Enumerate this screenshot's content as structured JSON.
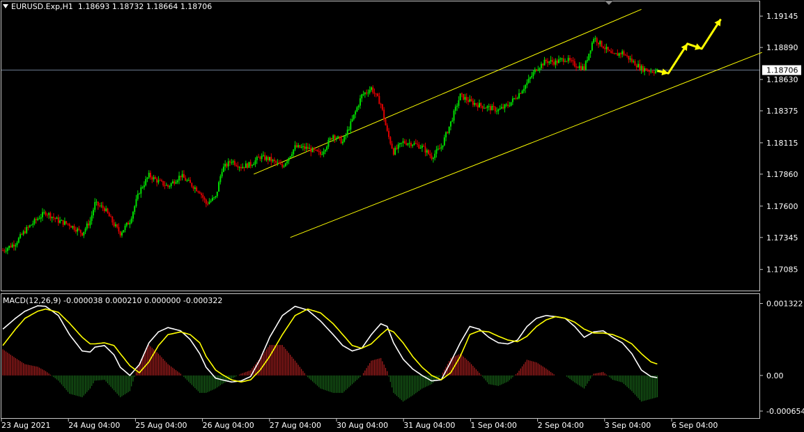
{
  "header": {
    "symbol": "EURUSD.Exp,H1",
    "ohlc": "1.18693 1.18732 1.18664 1.18706"
  },
  "macd_header": {
    "name": "MACD(12,26,9)",
    "values": "-0.000038 0.000210 0.000000 -0.000322"
  },
  "colors": {
    "background": "#000000",
    "bull": "#00e000",
    "bear": "#e00000",
    "channel": "#ffff00",
    "macd_main": "#ffffff",
    "macd_signal": "#ffff00",
    "hist_up": "#b02020",
    "hist_down": "#1a6a1a",
    "current_line": "#6f7f95"
  },
  "chart_data": [
    {
      "type": "candlestick",
      "title": "EURUSD.Exp,H1",
      "y_ticks": [
        "1.19145",
        "1.18890",
        "1.18630",
        "1.18375",
        "1.18115",
        "1.17860",
        "1.17600",
        "1.17345",
        "1.17085"
      ],
      "ylim": [
        1.17004,
        1.19225
      ],
      "current_price": "1.18706",
      "x_ticks": [
        "23 Aug 2021",
        "24 Aug 04:00",
        "25 Aug 04:00",
        "26 Aug 04:00",
        "27 Aug 04:00",
        "30 Aug 04:00",
        "31 Aug 04:00",
        "1 Sep 04:00",
        "2 Sep 04:00",
        "3 Sep 04:00",
        "6 Sep 04:00"
      ],
      "close_path": [
        [
          0,
          1.1724
        ],
        [
          8,
          1.173
        ],
        [
          14,
          1.174
        ],
        [
          22,
          1.175
        ],
        [
          27,
          1.1755
        ],
        [
          35,
          1.1748
        ],
        [
          42,
          1.1745
        ],
        [
          50,
          1.1738
        ],
        [
          55,
          1.1748
        ],
        [
          58,
          1.1762
        ],
        [
          64,
          1.1758
        ],
        [
          70,
          1.1745
        ],
        [
          74,
          1.1738
        ],
        [
          80,
          1.1748
        ],
        [
          86,
          1.1772
        ],
        [
          92,
          1.1785
        ],
        [
          98,
          1.178
        ],
        [
          104,
          1.1776
        ],
        [
          112,
          1.1785
        ],
        [
          118,
          1.1778
        ],
        [
          124,
          1.1772
        ],
        [
          128,
          1.1762
        ],
        [
          134,
          1.1767
        ],
        [
          138,
          1.179
        ],
        [
          144,
          1.1797
        ],
        [
          150,
          1.1792
        ],
        [
          156,
          1.1794
        ],
        [
          162,
          1.18
        ],
        [
          168,
          1.1798
        ],
        [
          176,
          1.1792
        ],
        [
          184,
          1.1808
        ],
        [
          192,
          1.1807
        ],
        [
          200,
          1.1802
        ],
        [
          208,
          1.1818
        ],
        [
          214,
          1.1812
        ],
        [
          220,
          1.183
        ],
        [
          226,
          1.185
        ],
        [
          232,
          1.1856
        ],
        [
          238,
          1.1843
        ],
        [
          242,
          1.182
        ],
        [
          246,
          1.1804
        ],
        [
          252,
          1.1812
        ],
        [
          258,
          1.1811
        ],
        [
          264,
          1.1808
        ],
        [
          270,
          1.18
        ],
        [
          276,
          1.1808
        ],
        [
          282,
          1.1828
        ],
        [
          288,
          1.185
        ],
        [
          294,
          1.1845
        ],
        [
          300,
          1.1842
        ],
        [
          306,
          1.184
        ],
        [
          312,
          1.1838
        ],
        [
          318,
          1.1842
        ],
        [
          324,
          1.185
        ],
        [
          330,
          1.186
        ],
        [
          336,
          1.1872
        ],
        [
          342,
          1.1878
        ],
        [
          348,
          1.1877
        ],
        [
          354,
          1.188
        ],
        [
          360,
          1.1875
        ],
        [
          366,
          1.1872
        ],
        [
          372,
          1.1897
        ],
        [
          378,
          1.189
        ],
        [
          384,
          1.1882
        ],
        [
          390,
          1.1885
        ],
        [
          396,
          1.1878
        ],
        [
          402,
          1.1872
        ],
        [
          408,
          1.187
        ],
        [
          412,
          1.187
        ]
      ],
      "forecast_path": [
        [
          412,
          1.187
        ],
        [
          419,
          1.1868
        ],
        [
          431,
          1.1892
        ],
        [
          440,
          1.1888
        ],
        [
          452,
          1.1912
        ]
      ],
      "channel_upper": [
        [
          0,
          1.1786
        ],
        [
          244,
          1.192
        ]
      ],
      "channel_lower": [
        [
          23,
          1.17345
        ],
        [
          320,
          1.1885
        ]
      ]
    },
    {
      "type": "macd",
      "title": "MACD(12,26,9)",
      "y_ticks": [
        "0.001322",
        "0.00",
        "-0.000654"
      ],
      "ylim": [
        -0.00068,
        0.00138
      ],
      "main": [
        [
          0,
          0.00085
        ],
        [
          8,
          0.00105
        ],
        [
          14,
          0.00118
        ],
        [
          22,
          0.00128
        ],
        [
          27,
          0.00127
        ],
        [
          35,
          0.0011
        ],
        [
          42,
          0.00075
        ],
        [
          50,
          0.00045
        ],
        [
          55,
          0.00043
        ],
        [
          58,
          0.00052
        ],
        [
          64,
          0.00055
        ],
        [
          70,
          0.00038
        ],
        [
          74,
          0.00015
        ],
        [
          80,
          0.0
        ],
        [
          86,
          0.0002
        ],
        [
          92,
          0.0006
        ],
        [
          98,
          0.0008
        ],
        [
          104,
          0.00088
        ],
        [
          112,
          0.00082
        ],
        [
          118,
          0.00066
        ],
        [
          124,
          0.0004
        ],
        [
          128,
          0.00015
        ],
        [
          134,
          -5e-05
        ],
        [
          138,
          -8e-05
        ],
        [
          144,
          -0.00012
        ],
        [
          150,
          -0.0001
        ],
        [
          156,
          -2e-05
        ],
        [
          162,
          0.0003
        ],
        [
          168,
          0.0007
        ],
        [
          176,
          0.0011
        ],
        [
          184,
          0.00127
        ],
        [
          192,
          0.0012
        ],
        [
          200,
          0.001
        ],
        [
          208,
          0.00075
        ],
        [
          214,
          0.00055
        ],
        [
          220,
          0.00045
        ],
        [
          226,
          0.0005
        ],
        [
          232,
          0.00075
        ],
        [
          238,
          0.00095
        ],
        [
          242,
          0.0009
        ],
        [
          246,
          0.0006
        ],
        [
          252,
          0.0003
        ],
        [
          258,
          0.00012
        ],
        [
          264,
          0.0
        ],
        [
          270,
          -0.0001
        ],
        [
          276,
          -8e-05
        ],
        [
          282,
          0.00025
        ],
        [
          288,
          0.0006
        ],
        [
          294,
          0.0009
        ],
        [
          300,
          0.00085
        ],
        [
          306,
          0.0007
        ],
        [
          312,
          0.0006
        ],
        [
          318,
          0.00058
        ],
        [
          324,
          0.00065
        ],
        [
          330,
          0.0009
        ],
        [
          336,
          0.00105
        ],
        [
          342,
          0.0011
        ],
        [
          348,
          0.00108
        ],
        [
          354,
          0.00105
        ],
        [
          360,
          0.0009
        ],
        [
          366,
          0.0007
        ],
        [
          372,
          0.0008
        ],
        [
          378,
          0.00082
        ],
        [
          384,
          0.0007
        ],
        [
          390,
          0.0006
        ],
        [
          396,
          0.0004
        ],
        [
          402,
          0.0001
        ],
        [
          408,
          -2e-05
        ],
        [
          412,
          -4e-05
        ]
      ],
      "signal": [
        [
          0,
          0.00055
        ],
        [
          8,
          0.00085
        ],
        [
          14,
          0.00105
        ],
        [
          22,
          0.00118
        ],
        [
          27,
          0.00122
        ],
        [
          35,
          0.00116
        ],
        [
          42,
          0.00096
        ],
        [
          50,
          0.0007
        ],
        [
          55,
          0.00058
        ],
        [
          58,
          0.00058
        ],
        [
          64,
          0.0006
        ],
        [
          70,
          0.00055
        ],
        [
          74,
          0.0004
        ],
        [
          80,
          0.00018
        ],
        [
          86,
          5e-05
        ],
        [
          92,
          0.00025
        ],
        [
          98,
          0.00055
        ],
        [
          104,
          0.00075
        ],
        [
          112,
          0.0008
        ],
        [
          118,
          0.00075
        ],
        [
          124,
          0.0006
        ],
        [
          128,
          0.00035
        ],
        [
          134,
          0.0001
        ],
        [
          138,
          2e-05
        ],
        [
          144,
          -8e-05
        ],
        [
          150,
          -0.00012
        ],
        [
          156,
          -8e-05
        ],
        [
          162,
          0.0001
        ],
        [
          168,
          0.00035
        ],
        [
          176,
          0.00075
        ],
        [
          184,
          0.0011
        ],
        [
          192,
          0.00122
        ],
        [
          200,
          0.00115
        ],
        [
          208,
          0.00095
        ],
        [
          214,
          0.00075
        ],
        [
          220,
          0.00055
        ],
        [
          226,
          0.0005
        ],
        [
          232,
          0.00058
        ],
        [
          238,
          0.00075
        ],
        [
          242,
          0.00085
        ],
        [
          246,
          0.0008
        ],
        [
          252,
          0.0006
        ],
        [
          258,
          0.00035
        ],
        [
          264,
          0.00015
        ],
        [
          270,
          0.0
        ],
        [
          276,
          -8e-05
        ],
        [
          282,
          5e-05
        ],
        [
          288,
          0.00035
        ],
        [
          294,
          0.00075
        ],
        [
          300,
          0.00082
        ],
        [
          306,
          0.0008
        ],
        [
          312,
          0.00072
        ],
        [
          318,
          0.00065
        ],
        [
          324,
          0.00062
        ],
        [
          330,
          0.00072
        ],
        [
          336,
          0.0009
        ],
        [
          342,
          0.00102
        ],
        [
          348,
          0.00108
        ],
        [
          354,
          0.00105
        ],
        [
          360,
          0.00098
        ],
        [
          366,
          0.00085
        ],
        [
          372,
          0.00078
        ],
        [
          378,
          0.00078
        ],
        [
          384,
          0.00075
        ],
        [
          390,
          0.00068
        ],
        [
          396,
          0.00058
        ],
        [
          402,
          0.0004
        ],
        [
          408,
          0.00025
        ],
        [
          412,
          0.00021
        ]
      ]
    }
  ]
}
